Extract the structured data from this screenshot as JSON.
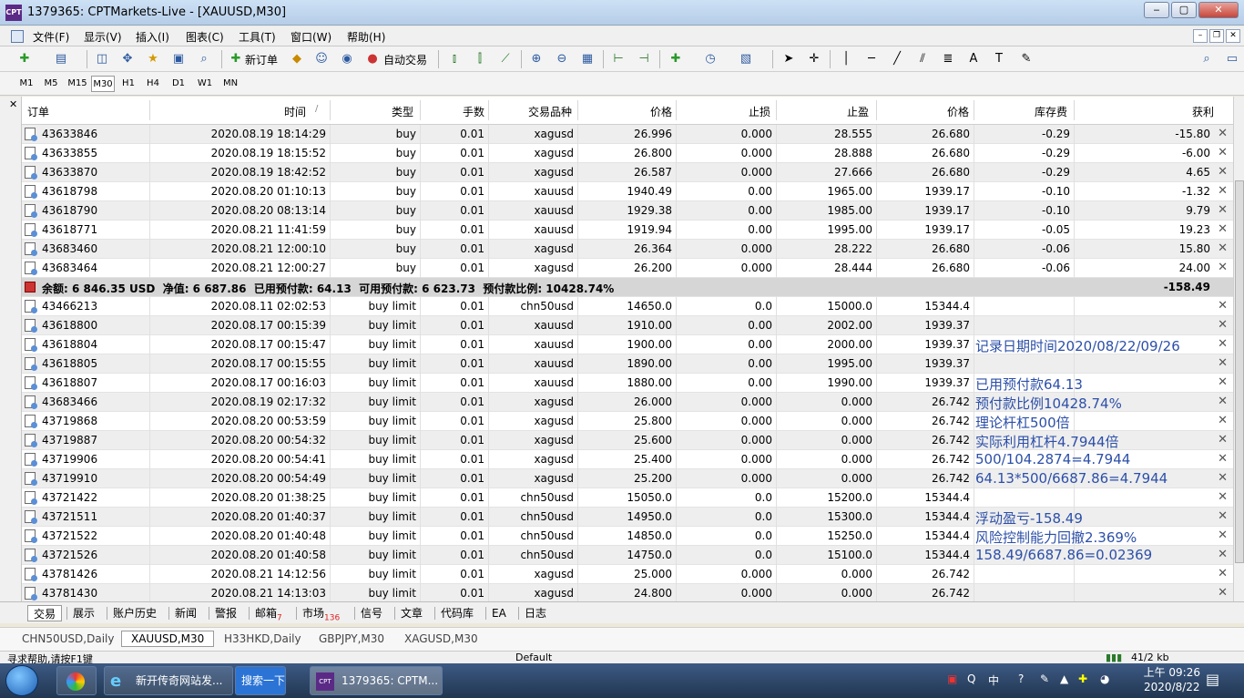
{
  "window": {
    "title": "1379365: CPTMarkets-Live - [XAUUSD,M30]",
    "icon_text": "CPT"
  },
  "menu": [
    "文件(F)",
    "显示(V)",
    "插入(I)",
    "图表(C)",
    "工具(T)",
    "窗口(W)",
    "帮助(H)"
  ],
  "toolbar": {
    "new_order": "新订单",
    "auto_trade": "自动交易"
  },
  "timeframes": [
    "M1",
    "M5",
    "M15",
    "M30",
    "H1",
    "H4",
    "D1",
    "W1",
    "MN"
  ],
  "active_timeframe": "M30",
  "table": {
    "headers": [
      "订单",
      "时间",
      "类型",
      "手数",
      "交易品种",
      "价格",
      "止损",
      "止盈",
      "价格",
      "库存费",
      "获利"
    ],
    "sort_indicator": "/",
    "open_rows": [
      [
        "43633846",
        "2020.08.19 18:14:29",
        "buy",
        "0.01",
        "xagusd",
        "26.996",
        "0.000",
        "28.555",
        "26.680",
        "-0.29",
        "-15.80"
      ],
      [
        "43633855",
        "2020.08.19 18:15:52",
        "buy",
        "0.01",
        "xagusd",
        "26.800",
        "0.000",
        "28.888",
        "26.680",
        "-0.29",
        "-6.00"
      ],
      [
        "43633870",
        "2020.08.19 18:42:52",
        "buy",
        "0.01",
        "xagusd",
        "26.587",
        "0.000",
        "27.666",
        "26.680",
        "-0.29",
        "4.65"
      ],
      [
        "43618798",
        "2020.08.20 01:10:13",
        "buy",
        "0.01",
        "xauusd",
        "1940.49",
        "0.00",
        "1965.00",
        "1939.17",
        "-0.10",
        "-1.32"
      ],
      [
        "43618790",
        "2020.08.20 08:13:14",
        "buy",
        "0.01",
        "xauusd",
        "1929.38",
        "0.00",
        "1985.00",
        "1939.17",
        "-0.10",
        "9.79"
      ],
      [
        "43618771",
        "2020.08.21 11:41:59",
        "buy",
        "0.01",
        "xauusd",
        "1919.94",
        "0.00",
        "1995.00",
        "1939.17",
        "-0.05",
        "19.23"
      ],
      [
        "43683460",
        "2020.08.21 12:00:10",
        "buy",
        "0.01",
        "xagusd",
        "26.364",
        "0.000",
        "28.222",
        "26.680",
        "-0.06",
        "15.80"
      ],
      [
        "43683464",
        "2020.08.21 12:00:27",
        "buy",
        "0.01",
        "xagusd",
        "26.200",
        "0.000",
        "28.444",
        "26.680",
        "-0.06",
        "24.00"
      ]
    ],
    "summary": {
      "text": "余额: 6 846.35 USD  净值: 6 687.86  已用预付款: 64.13  可用预付款: 6 623.73  预付款比例: 10428.74%",
      "profit": "-158.49"
    },
    "pending_rows": [
      [
        "43466213",
        "2020.08.11 02:02:53",
        "buy limit",
        "0.01",
        "chn50usd",
        "14650.0",
        "0.0",
        "15000.0",
        "15344.4"
      ],
      [
        "43618800",
        "2020.08.17 00:15:39",
        "buy limit",
        "0.01",
        "xauusd",
        "1910.00",
        "0.00",
        "2002.00",
        "1939.37"
      ],
      [
        "43618804",
        "2020.08.17 00:15:47",
        "buy limit",
        "0.01",
        "xauusd",
        "1900.00",
        "0.00",
        "2000.00",
        "1939.37"
      ],
      [
        "43618805",
        "2020.08.17 00:15:55",
        "buy limit",
        "0.01",
        "xauusd",
        "1890.00",
        "0.00",
        "1995.00",
        "1939.37"
      ],
      [
        "43618807",
        "2020.08.17 00:16:03",
        "buy limit",
        "0.01",
        "xauusd",
        "1880.00",
        "0.00",
        "1990.00",
        "1939.37"
      ],
      [
        "43683466",
        "2020.08.19 02:17:32",
        "buy limit",
        "0.01",
        "xagusd",
        "26.000",
        "0.000",
        "0.000",
        "26.742"
      ],
      [
        "43719868",
        "2020.08.20 00:53:59",
        "buy limit",
        "0.01",
        "xagusd",
        "25.800",
        "0.000",
        "0.000",
        "26.742"
      ],
      [
        "43719887",
        "2020.08.20 00:54:32",
        "buy limit",
        "0.01",
        "xagusd",
        "25.600",
        "0.000",
        "0.000",
        "26.742"
      ],
      [
        "43719906",
        "2020.08.20 00:54:41",
        "buy limit",
        "0.01",
        "xagusd",
        "25.400",
        "0.000",
        "0.000",
        "26.742"
      ],
      [
        "43719910",
        "2020.08.20 00:54:49",
        "buy limit",
        "0.01",
        "xagusd",
        "25.200",
        "0.000",
        "0.000",
        "26.742"
      ],
      [
        "43721422",
        "2020.08.20 01:38:25",
        "buy limit",
        "0.01",
        "chn50usd",
        "15050.0",
        "0.0",
        "15200.0",
        "15344.4"
      ],
      [
        "43721511",
        "2020.08.20 01:40:37",
        "buy limit",
        "0.01",
        "chn50usd",
        "14950.0",
        "0.0",
        "15300.0",
        "15344.4"
      ],
      [
        "43721522",
        "2020.08.20 01:40:48",
        "buy limit",
        "0.01",
        "chn50usd",
        "14850.0",
        "0.0",
        "15250.0",
        "15344.4"
      ],
      [
        "43721526",
        "2020.08.20 01:40:58",
        "buy limit",
        "0.01",
        "chn50usd",
        "14750.0",
        "0.0",
        "15100.0",
        "15344.4"
      ],
      [
        "43781426",
        "2020.08.21 14:12:56",
        "buy limit",
        "0.01",
        "xagusd",
        "25.000",
        "0.000",
        "0.000",
        "26.742"
      ],
      [
        "43781430",
        "2020.08.21 14:13:03",
        "buy limit",
        "0.01",
        "xagusd",
        "24.800",
        "0.000",
        "0.000",
        "26.742"
      ]
    ]
  },
  "notes": [
    {
      "text": "记录日期时间2020/08/22/09/26",
      "row": 11
    },
    {
      "text": "已用预付款64.13",
      "row": 13
    },
    {
      "text": "预付款比例10428.74%",
      "row": 14
    },
    {
      "text": "理论杆杠500倍",
      "row": 15
    },
    {
      "text": "实际利用杠杆4.7944倍",
      "row": 16
    },
    {
      "text": "500/104.2874=4.7944",
      "row": 17
    },
    {
      "text": "64.13*500/6687.86=4.7944",
      "row": 18
    },
    {
      "text": "浮动盈亏-158.49",
      "row": 20
    },
    {
      "text": "风险控制能力回撤2.369%",
      "row": 21
    },
    {
      "text": "158.49/6687.86=0.02369",
      "row": 22
    }
  ],
  "bottom_tabs": [
    {
      "label": "交易",
      "badge": ""
    },
    {
      "label": "展示",
      "badge": ""
    },
    {
      "label": "账户历史",
      "badge": ""
    },
    {
      "label": "新闻",
      "badge": ""
    },
    {
      "label": "警报",
      "badge": ""
    },
    {
      "label": "邮箱",
      "badge": "7"
    },
    {
      "label": "市场",
      "badge": "136"
    },
    {
      "label": "信号",
      "badge": ""
    },
    {
      "label": "文章",
      "badge": ""
    },
    {
      "label": "代码库",
      "badge": ""
    },
    {
      "label": "EA",
      "badge": ""
    },
    {
      "label": "日志",
      "badge": ""
    }
  ],
  "chart_tabs": [
    "CHN50USD,Daily",
    "XAUUSD,M30",
    "H33HKD,Daily",
    "GBPJPY,M30",
    "XAGUSD,M30"
  ],
  "active_chart_tab": "XAUUSD,M30",
  "status": {
    "help": "寻求帮助,请按F1键",
    "profile": "Default",
    "traffic": "41/2 kb"
  },
  "taskbar": {
    "ie_label": "新开传奇网站发...",
    "search_label": "搜索一下",
    "mt4_label": "1379365: CPTM...",
    "ime": "中",
    "time_ampm": "上午 09:26",
    "date": "2020/8/22"
  }
}
